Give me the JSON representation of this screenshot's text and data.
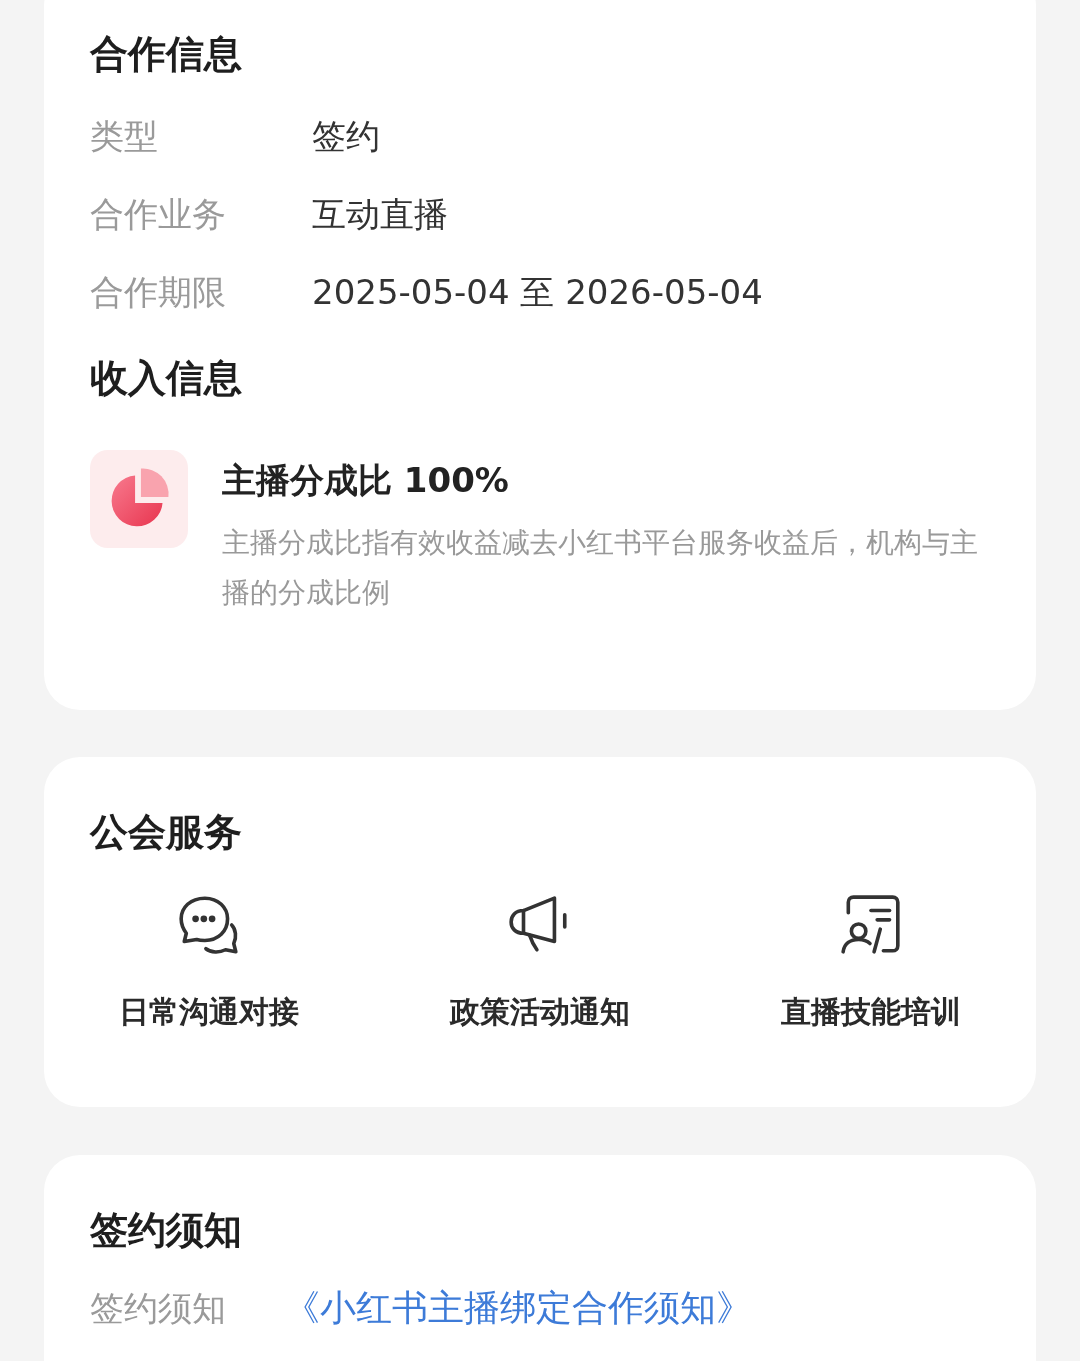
{
  "cooperation": {
    "title": "合作信息",
    "rows": [
      {
        "label": "类型",
        "value": "签约"
      },
      {
        "label": "合作业务",
        "value": "互动直播"
      },
      {
        "label": "合作期限",
        "value": "2025-05-04 至 2026-05-04"
      }
    ]
  },
  "income": {
    "title": "收入信息",
    "name": "主播分成比 100%",
    "description": "主播分成比指有效收益减去小红书平台服务收益后，机构与主播的分成比例"
  },
  "services": {
    "title": "公会服务",
    "items": [
      {
        "kind": "chat",
        "label": "日常沟通对接"
      },
      {
        "kind": "megaphone",
        "label": "政策活动通知"
      },
      {
        "kind": "training",
        "label": "直播技能培训"
      }
    ]
  },
  "notice": {
    "title": "签约须知",
    "label": "签约须知",
    "link": "《小红书主播绑定合作须知》"
  }
}
